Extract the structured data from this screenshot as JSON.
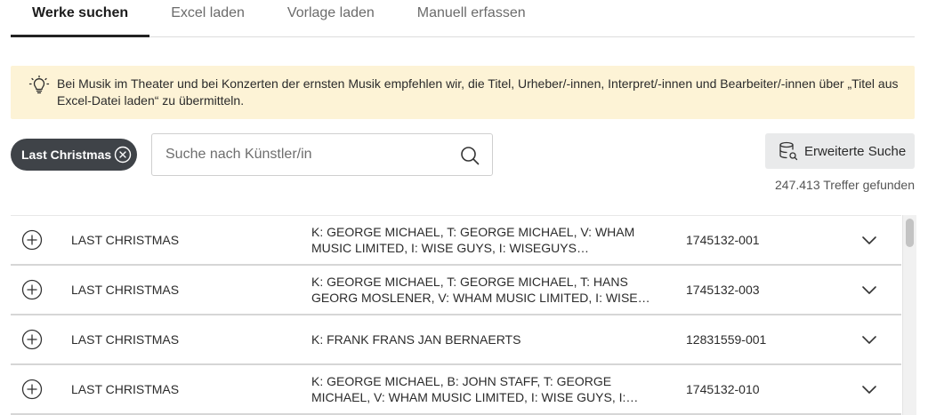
{
  "tabs": [
    {
      "label": "Werke suchen",
      "active": true
    },
    {
      "label": "Excel laden",
      "active": false
    },
    {
      "label": "Vorlage laden",
      "active": false
    },
    {
      "label": "Manuell erfassen",
      "active": false
    }
  ],
  "banner": {
    "icon": "lightbulb-icon",
    "text": "Bei Musik im Theater und bei Konzerten der ernsten Musik empfehlen wir, die Titel, Urheber/-innen, Interpret/-innen und Bearbeiter/-innen über „Titel aus Excel-Datei laden“ zu übermitteln."
  },
  "search": {
    "chip_label": "Last Christmas",
    "placeholder": "Suche nach Künstler/in",
    "advanced_label": "Erweiterte Suche",
    "hits": "247.413 Treffer gefunden"
  },
  "results": [
    {
      "title": "LAST CHRISTMAS",
      "persons": "K: GEORGE MICHAEL, T: GEORGE MICHAEL, V: WHAM MUSIC LIMITED, I: WISE GUYS, I: WISEGUYS FEAT.A.HUERTH, I: BRING...",
      "code": "1745132-001"
    },
    {
      "title": "LAST CHRISTMAS",
      "persons": "K: GEORGE MICHAEL, T: GEORGE MICHAEL, T: HANS GEORG MOSLENER, V: WHAM MUSIC LIMITED, I: WISE GUYS, I: WISE-...",
      "code": "1745132-003"
    },
    {
      "title": "LAST CHRISTMAS",
      "persons": "K: FRANK FRANS JAN BERNAERTS",
      "code": "12831559-001"
    },
    {
      "title": "LAST CHRISTMAS",
      "persons": "K: GEORGE MICHAEL, B: JOHN STAFF, T: GEORGE MICHAEL, V: WHAM MUSIC LIMITED, I: WISE GUYS, I: WISEGUYS FEAT.A.H...",
      "code": "1745132-010"
    }
  ]
}
